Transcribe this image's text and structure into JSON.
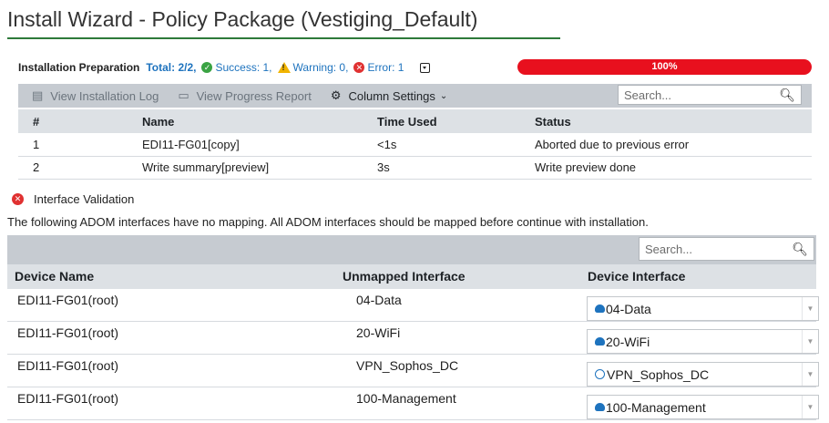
{
  "title": "Install Wizard - Policy Package (Vestiging_Default)",
  "prep": {
    "label": "Installation Preparation",
    "total": "Total: 2/2,",
    "success": "Success: 1,",
    "warning": "Warning: 0,",
    "error": "Error: 1",
    "progress_text": "100%",
    "progress_value": 1.0
  },
  "toolbar": {
    "view_log": "View Installation Log",
    "view_progress": "View Progress Report",
    "column_settings": "Column Settings",
    "search_placeholder": "Search..."
  },
  "prep_table": {
    "headers": [
      "#",
      "Name",
      "Time Used",
      "Status"
    ],
    "rows": [
      [
        "1",
        "EDI11-FG01[copy]",
        "<1s",
        "Aborted due to previous error"
      ],
      [
        "2",
        "Write summary[preview]",
        "3s",
        "Write preview done"
      ]
    ]
  },
  "interface_validation": {
    "label": "Interface Validation",
    "note": "The following ADOM interfaces have no mapping. All ADOM interfaces should be mapped before continue with installation.",
    "search_placeholder": "Search...",
    "headers": [
      "Device Name",
      "Unmapped Interface",
      "Device Interface"
    ],
    "rows": [
      {
        "device": "EDI11-FG01(root)",
        "unmapped": "04-Data",
        "mapped": "04-Data",
        "icon": "cloud-icon"
      },
      {
        "device": "EDI11-FG01(root)",
        "unmapped": "20-WiFi",
        "mapped": "20-WiFi",
        "icon": "cloud-icon"
      },
      {
        "device": "EDI11-FG01(root)",
        "unmapped": "VPN_Sophos_DC",
        "mapped": "VPN_Sophos_DC",
        "icon": "vpn-icon"
      },
      {
        "device": "EDI11-FG01(root)",
        "unmapped": "100-Management",
        "mapped": "100-Management",
        "icon": "cloud-icon"
      }
    ]
  },
  "colors": {
    "accent_green": "#2d7a3a",
    "progress_red": "#e8101e",
    "link_blue": "#1e73be"
  }
}
